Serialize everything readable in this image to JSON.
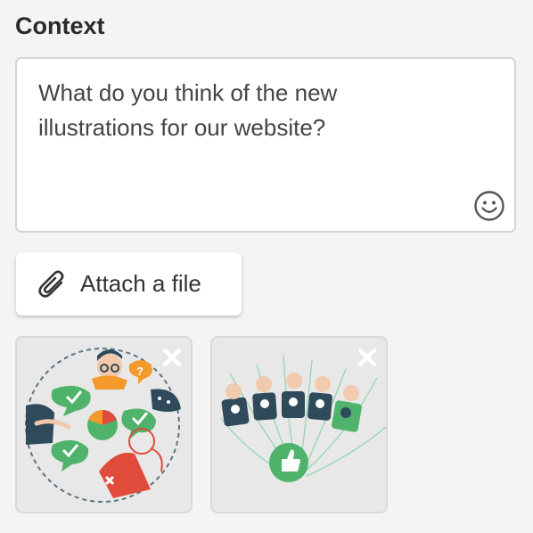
{
  "section": {
    "title": "Context"
  },
  "message": {
    "text": "What do you think of the new illustrations for our website?"
  },
  "attach": {
    "label": "Attach a file"
  },
  "attachments": [
    {
      "name": "illustration-1",
      "remove_icon": "close-icon"
    },
    {
      "name": "illustration-2",
      "remove_icon": "close-icon"
    }
  ],
  "icons": {
    "emoji": "smiley-icon",
    "attach": "paperclip-icon"
  },
  "colors": {
    "accent_green": "#4fb36b",
    "dark_teal": "#2f4a5a",
    "accent_red": "#e14b3b",
    "accent_orange": "#f39a2b"
  }
}
